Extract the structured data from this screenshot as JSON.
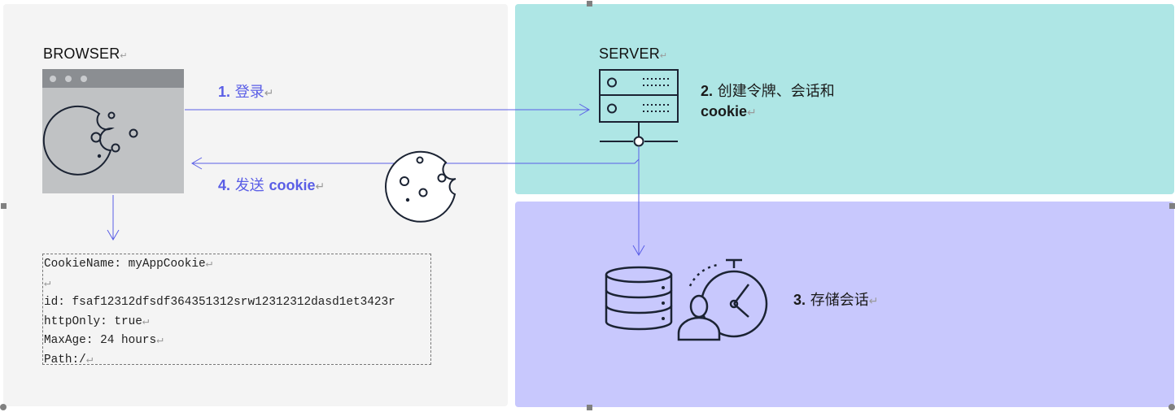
{
  "browser": {
    "label": "BROWSER"
  },
  "server": {
    "label": "SERVER"
  },
  "steps": {
    "login": {
      "num": "1.",
      "text": "登录"
    },
    "create": {
      "num": "2.",
      "text_line1": "创建令牌、会话和",
      "text_line2": "cookie"
    },
    "store": {
      "num": "3.",
      "text": "存储会话"
    },
    "send": {
      "num": "4.",
      "text_a": "发送",
      "text_b": "cookie"
    }
  },
  "cookie_info": {
    "line1": "CookieName: myAppCookie",
    "line2": "",
    "line3": "id: fsaf12312dfsdf364351312srw12312312dasd1et3423r",
    "line4": "httpOnly: true",
    "line5": "MaxAge: 24 hours",
    "line6": "Path:/"
  },
  "colors": {
    "left_panel": "#f4f4f4",
    "server_panel": "#aee6e5",
    "store_panel": "#c8c8fd",
    "arrow": "#5a5ee6",
    "accent_text": "#5a5ee6"
  }
}
